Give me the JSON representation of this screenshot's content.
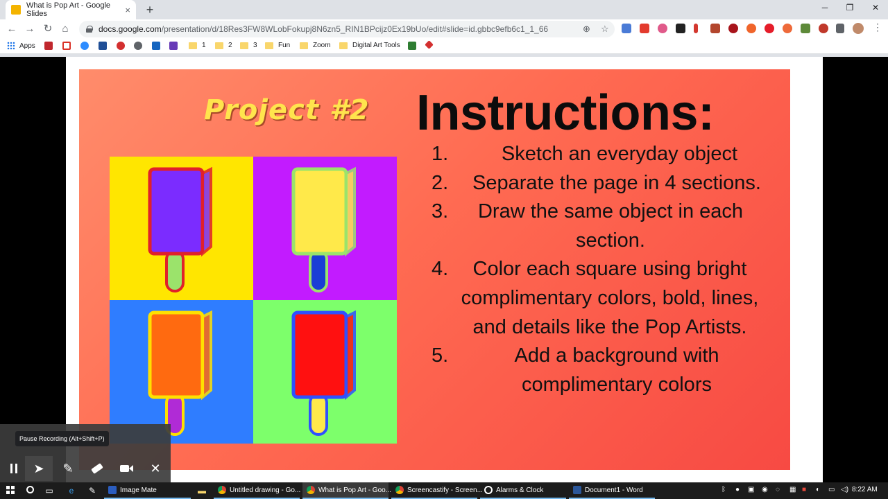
{
  "browser": {
    "tab_title": "What is Pop Art - Google Slides",
    "tab_close": "×",
    "new_tab": "+",
    "url_host": "docs.google.com",
    "url_path": "/presentation/d/18Res3FW8WLobFokupj8N6zn5_RIN1BPcijz0Ex19bUo/edit#slide=id.gbbc9efb6c1_1_66",
    "minimize": "─",
    "maximize": "❐",
    "close": "✕"
  },
  "bookmarks": [
    {
      "label": "Apps"
    },
    {
      "label": "1"
    },
    {
      "label": "2"
    },
    {
      "label": "3"
    },
    {
      "label": "Fun"
    },
    {
      "label": "Zoom"
    },
    {
      "label": "Digital Art Tools"
    }
  ],
  "slide": {
    "project_title": "Project #2",
    "heading": "Instructions:",
    "steps": [
      {
        "num": "1.",
        "text": "Sketch an everyday object"
      },
      {
        "num": "2.",
        "text": "Separate the page in 4 sections."
      },
      {
        "num": "3.",
        "text": "Draw the same object in each section."
      },
      {
        "num": "4.",
        "text": "Color each square using bright complimentary colors, bold, lines, and details like the Pop Artists."
      },
      {
        "num": "5.",
        "text": "Add a background with complimentary colors"
      }
    ],
    "quadrants": [
      {
        "bg": "#ffe600",
        "popsicle": "#7b2cff",
        "outline": "#e0202a",
        "stick": "#9be36b"
      },
      {
        "bg": "#c21bff",
        "popsicle": "#ffe94a",
        "outline": "#9be36b",
        "stick": "#1a3ed6"
      },
      {
        "bg": "#2f7dff",
        "popsicle": "#ff6a10",
        "outline": "#ffe000",
        "stick": "#b02bd6"
      },
      {
        "bg": "#7dff6b",
        "popsicle": "#ff1010",
        "outline": "#2f50ff",
        "stick": "#ffe94a"
      }
    ]
  },
  "screencastify": {
    "tooltip": "Pause Recording (Alt+Shift+P)",
    "pause_icon": "pause-icon",
    "tools": [
      "cursor-icon",
      "pen-icon",
      "eraser-icon",
      "camera-icon",
      "close-icon"
    ]
  },
  "taskbar": {
    "items": [
      {
        "label": "Image Mate",
        "color": "#2b5dbf"
      },
      {
        "label": "Untitled drawing - Go...",
        "color": "#e8453c"
      },
      {
        "label": "What is Pop Art - Goo...",
        "color": "#e8453c"
      },
      {
        "label": "Screencastify - Screen...",
        "color": "#e8453c"
      },
      {
        "label": "Alarms & Clock",
        "color": "#ffffff"
      },
      {
        "label": "Document1 - Word",
        "color": "#2b579a"
      }
    ],
    "time": "8:22 AM"
  }
}
